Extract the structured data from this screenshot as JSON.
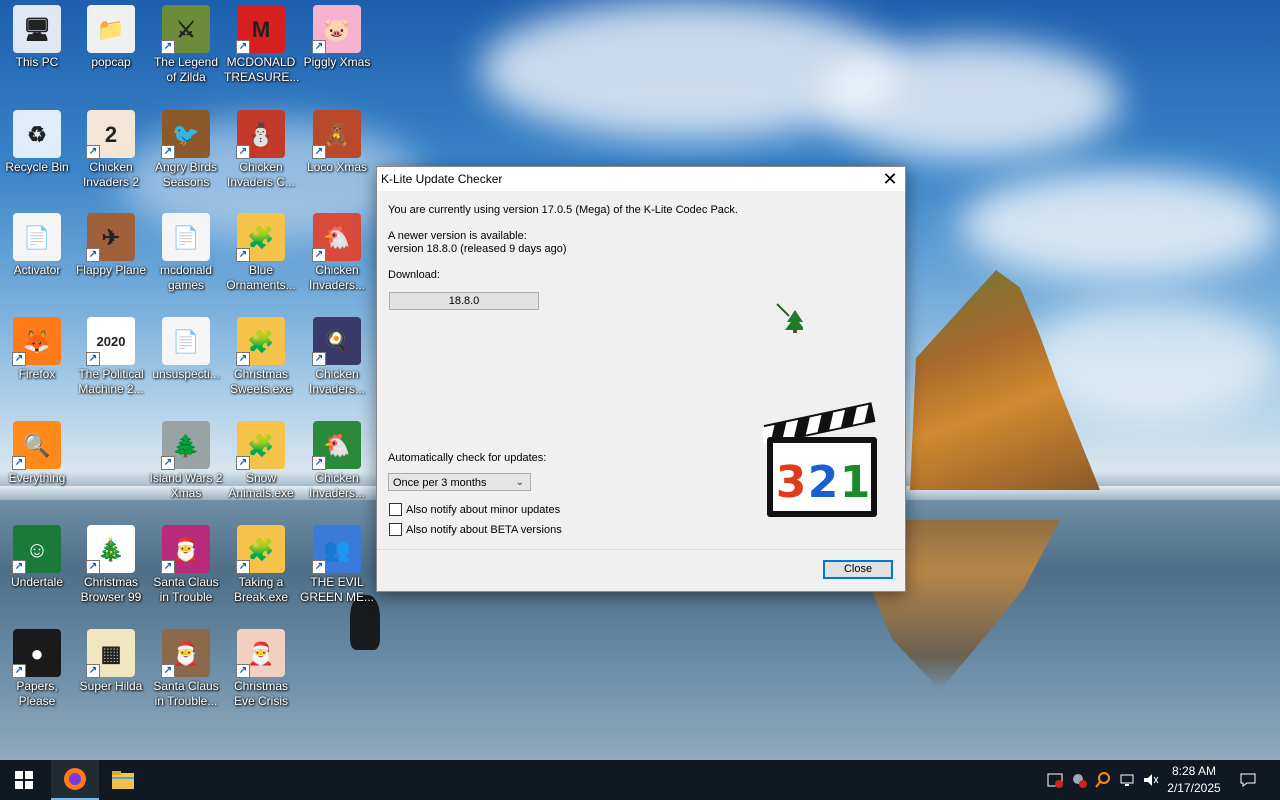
{
  "desktop": {
    "icons": [
      {
        "label": "This PC",
        "symbol": "🖥",
        "bg": "#dfe8f3",
        "shortcut": false
      },
      {
        "label": "popcap",
        "symbol": "📁",
        "bg": "#f0f0f0",
        "shortcut": false
      },
      {
        "label": "The Legend of Zilda",
        "symbol": "⚔",
        "bg": "#6b8c3a",
        "shortcut": true
      },
      {
        "label": "MCDONALD TREASURE...",
        "symbol": "M",
        "bg": "#d81f1f",
        "shortcut": true
      },
      {
        "label": "Piggly Xmas",
        "symbol": "🐷",
        "bg": "#f5b3cf",
        "shortcut": true
      },
      {
        "label": "Recycle Bin",
        "symbol": "♻",
        "bg": "#dfeef8",
        "shortcut": false
      },
      {
        "label": "Chicken Invaders 2",
        "symbol": "2",
        "bg": "#f3e6d6",
        "shortcut": true
      },
      {
        "label": "Angry Birds Seasons",
        "symbol": "🐦",
        "bg": "#8c5a2a",
        "shortcut": true
      },
      {
        "label": "Chicken Invaders C...",
        "symbol": "⛄",
        "bg": "#c43a2a",
        "shortcut": true
      },
      {
        "label": "Loco Xmas",
        "symbol": "🧸",
        "bg": "#b84a2a",
        "shortcut": true
      },
      {
        "label": "Activator",
        "symbol": "📄",
        "bg": "#f5f5f5",
        "shortcut": false
      },
      {
        "label": "Flappy Plane",
        "symbol": "✈",
        "bg": "#a0603a",
        "shortcut": true
      },
      {
        "label": "mcdonald games",
        "symbol": "📄",
        "bg": "#f5f5f5",
        "shortcut": false
      },
      {
        "label": "Blue Ornaments...",
        "symbol": "🧩",
        "bg": "#f6c34a",
        "shortcut": true
      },
      {
        "label": "Chicken Invaders...",
        "symbol": "🐔",
        "bg": "#d94a3a",
        "shortcut": true
      },
      {
        "label": "Firefox",
        "symbol": "🦊",
        "bg": "#ff7a18",
        "shortcut": true
      },
      {
        "label": "The Political Machine 2...",
        "symbol": "2020",
        "bg": "#ffffff",
        "shortcut": true
      },
      {
        "label": "unsuspecti...",
        "symbol": "📄",
        "bg": "#f5f5f5",
        "shortcut": false
      },
      {
        "label": "Christmas Sweets.exe",
        "symbol": "🧩",
        "bg": "#f6c34a",
        "shortcut": true
      },
      {
        "label": "Chicken Invaders...",
        "symbol": "🍳",
        "bg": "#3a3a6a",
        "shortcut": true
      },
      {
        "label": "Everything",
        "symbol": "🔍",
        "bg": "#ff8a1a",
        "shortcut": true
      },
      {
        "label": "Island Wars 2 Xmas",
        "symbol": "🌲",
        "bg": "#9aa3a3",
        "shortcut": true
      },
      {
        "label": "Snow Animals.exe",
        "symbol": "🧩",
        "bg": "#f6c34a",
        "shortcut": true
      },
      {
        "label": "Chicken Invaders...",
        "symbol": "🐔",
        "bg": "#2a8a3a",
        "shortcut": true
      },
      {
        "label": "Undertale",
        "symbol": "☺",
        "bg": "#1a7a3a",
        "shortcut": true
      },
      {
        "label": "Christmas Browser 99",
        "symbol": "🎄",
        "bg": "#ffffff",
        "shortcut": true
      },
      {
        "label": "Santa Claus in Trouble",
        "symbol": "🎅",
        "bg": "#b82a7a",
        "shortcut": true
      },
      {
        "label": "Taking a Break.exe",
        "symbol": "🧩",
        "bg": "#f6c34a",
        "shortcut": true
      },
      {
        "label": "THE EVIL GREEN ME...",
        "symbol": "👥",
        "bg": "#3a7ad9",
        "shortcut": true
      },
      {
        "label": "Papers, Please",
        "symbol": "●",
        "bg": "#1a1a1a",
        "shortcut": true
      },
      {
        "label": "Super Hilda",
        "symbol": "▦",
        "bg": "#f0e6c0",
        "shortcut": true
      },
      {
        "label": "Santa Claus in Trouble...",
        "symbol": "🎅",
        "bg": "#8a6a4a",
        "shortcut": true
      },
      {
        "label": "Christmas Eve Crisis",
        "symbol": "🎅",
        "bg": "#f2d0c0",
        "shortcut": true
      }
    ]
  },
  "dialog": {
    "title": "K-Lite Update Checker",
    "current_version_text": "You are currently using version 17.0.5 (Mega) of the K-Lite Codec Pack.",
    "newer_line1": "A newer version is available:",
    "newer_line2": "version 18.8.0  (released 9 days ago)",
    "download_label": "Download:",
    "download_button": "18.8.0",
    "auto_check_label": "Automatically check for updates:",
    "auto_check_value": "Once per 3 months",
    "checkbox_minor": "Also notify about minor updates",
    "checkbox_beta": "Also notify about BETA versions",
    "close_button": "Close",
    "logo_digits": [
      "3",
      "2",
      "1"
    ],
    "colors": {
      "accent": "#0078d7"
    }
  },
  "taskbar": {
    "time": "8:28 AM",
    "date": "2/17/2025"
  }
}
